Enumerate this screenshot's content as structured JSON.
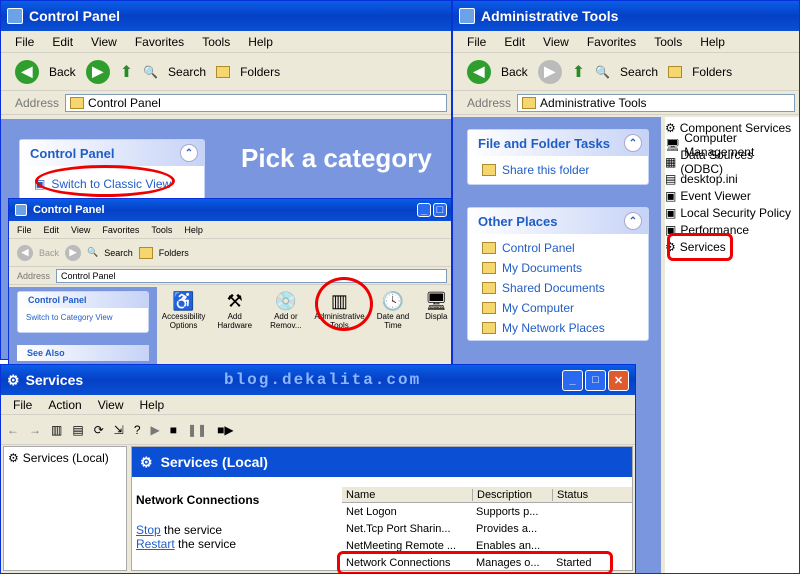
{
  "cp": {
    "title": "Control Panel",
    "menu": [
      "File",
      "Edit",
      "View",
      "Favorites",
      "Tools",
      "Help"
    ],
    "back": "Back",
    "search": "Search",
    "folders": "Folders",
    "address_label": "Address",
    "address": "Control Panel",
    "side_title": "Control Panel",
    "switch_link": "Switch to Classic View",
    "pick": "Pick a category"
  },
  "cp2": {
    "title": "Control Panel",
    "menu": [
      "File",
      "Edit",
      "View",
      "Favorites",
      "Tools",
      "Help"
    ],
    "back": "Back",
    "search": "Search",
    "folders": "Folders",
    "address_label": "Address",
    "address": "Control Panel",
    "side_title": "Control Panel",
    "switch_link": "Switch to Category View",
    "see_also": "See Also",
    "icons": [
      {
        "label": "Accessibility Options"
      },
      {
        "label": "Add Hardware"
      },
      {
        "label": "Add or Remov..."
      },
      {
        "label": "Administrative Tools"
      },
      {
        "label": "Date and Time"
      },
      {
        "label": "Displa"
      }
    ]
  },
  "at": {
    "title": "Administrative Tools",
    "menu": [
      "File",
      "Edit",
      "View",
      "Favorites",
      "Tools",
      "Help"
    ],
    "back": "Back",
    "search": "Search",
    "folders": "Folders",
    "address_label": "Address",
    "address": "Administrative Tools",
    "tasks_title": "File and Folder Tasks",
    "share": "Share this folder",
    "other_title": "Other Places",
    "other": [
      "Control Panel",
      "My Documents",
      "Shared Documents",
      "My Computer",
      "My Network Places"
    ],
    "files": [
      "Component Services",
      "Computer Management",
      "Data Sources (ODBC)",
      "desktop.ini",
      "Event Viewer",
      "Local Security Policy",
      "Performance",
      "Services"
    ]
  },
  "svc": {
    "title": "Services",
    "watermark": "blog.dekalita.com",
    "menu": [
      "File",
      "Action",
      "View",
      "Help"
    ],
    "tree_item": "Services (Local)",
    "header": "Services (Local)",
    "selected_name": "Network Connections",
    "stop": "Stop",
    "stop_rest": " the service",
    "restart": "Restart",
    "restart_rest": " the service",
    "columns": [
      "Name",
      "Description",
      "Status"
    ],
    "rows": [
      {
        "name": "Net Logon",
        "desc": "Supports p...",
        "status": ""
      },
      {
        "name": "Net.Tcp Port Sharin...",
        "desc": "Provides a...",
        "status": ""
      },
      {
        "name": "NetMeeting Remote ...",
        "desc": "Enables an...",
        "status": ""
      },
      {
        "name": "Network Connections",
        "desc": "Manages o...",
        "status": "Started"
      }
    ]
  },
  "colors": {
    "accent": "#0a5ee6",
    "link": "#215dc6",
    "highlight": "#e00000"
  }
}
